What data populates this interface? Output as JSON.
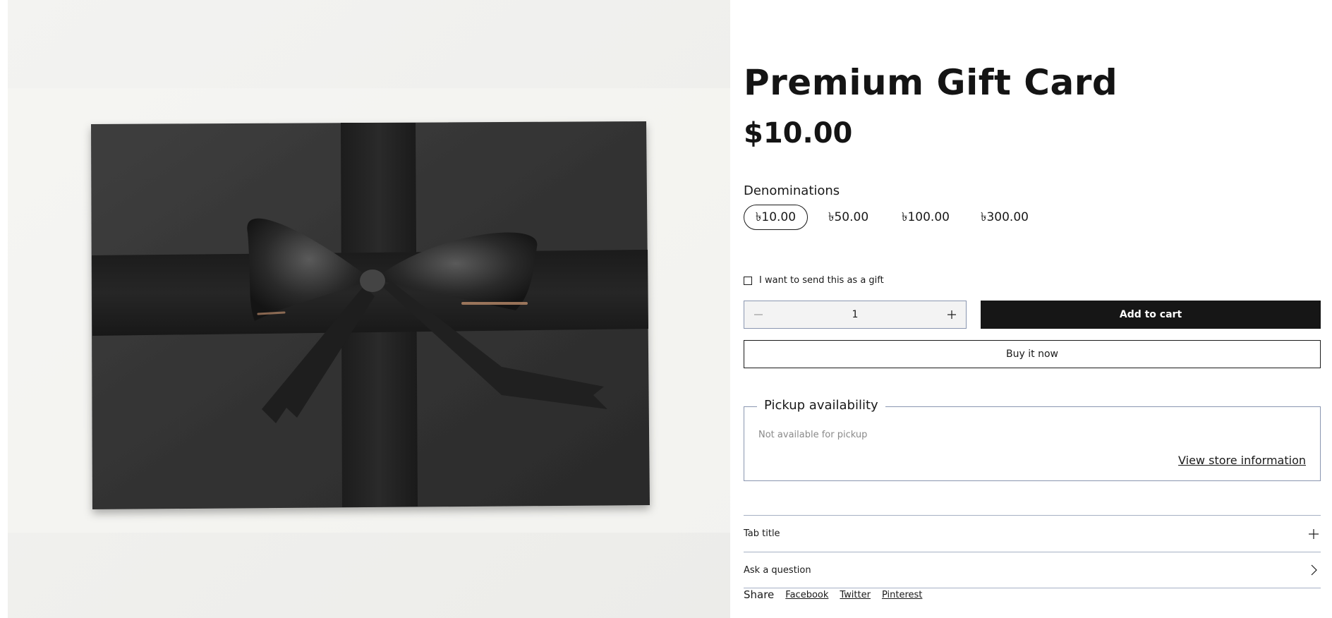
{
  "product": {
    "title": "Premium Gift Card",
    "price": "$10.00",
    "image_alt": "Black gift box with black satin ribbon bow"
  },
  "denominations": {
    "label": "Denominations",
    "options": [
      "৳10.00",
      "৳50.00",
      "৳100.00",
      "৳300.00"
    ],
    "selected": "৳10.00"
  },
  "gift": {
    "label": "I want to send this as a gift",
    "checked": false
  },
  "quantity": {
    "value": "1",
    "decrease_icon": "minus-icon",
    "increase_icon": "plus-icon"
  },
  "actions": {
    "add_to_cart": "Add to cart",
    "buy_now": "Buy it now"
  },
  "pickup": {
    "heading": "Pickup availability",
    "status": "Not available for pickup",
    "link": "View store information"
  },
  "accordions": [
    {
      "label": "Tab title",
      "icon": "plus-icon"
    },
    {
      "label": "Ask a question",
      "icon": "chevron-right-icon"
    }
  ],
  "share": {
    "label": "Share",
    "links": [
      "Facebook",
      "Twitter",
      "Pinterest"
    ]
  },
  "colors": {
    "primary": "#161616",
    "background": "#ffffff",
    "media_background": "#f1f1ef",
    "border": "#8a96b0",
    "muted_text": "#8a8a8a"
  }
}
